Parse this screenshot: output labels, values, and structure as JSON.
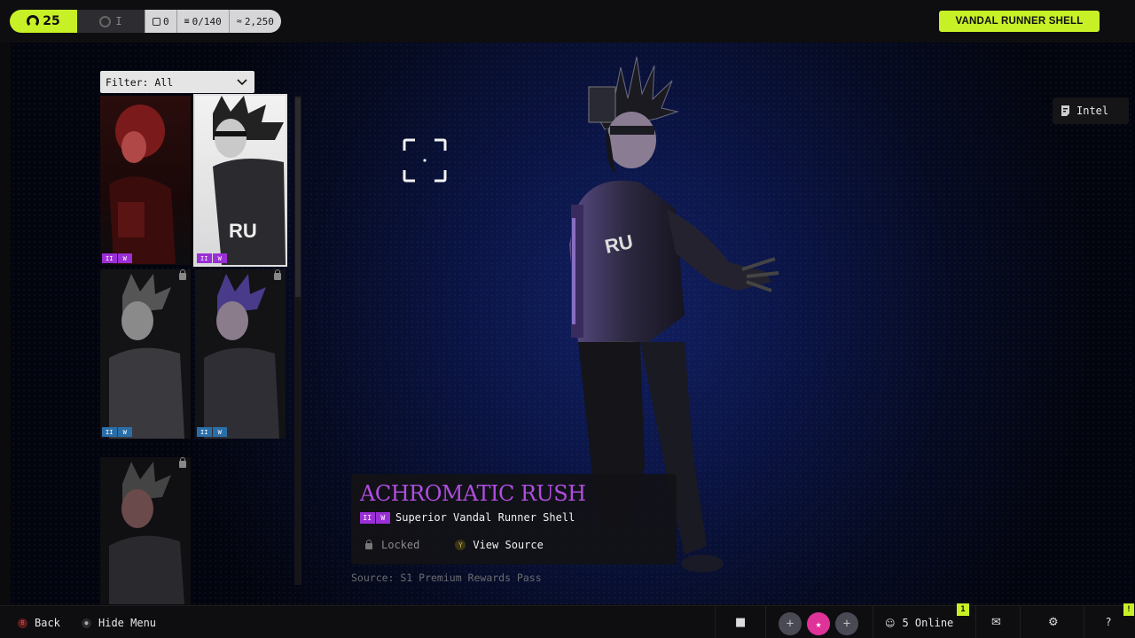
{
  "topbar": {
    "level": "25",
    "rank_label": "I",
    "stat_box": "0",
    "stat_progress": "0/140",
    "stat_currency": "2,250",
    "shell_badge": "VANDAL RUNNER SHELL"
  },
  "filter": {
    "label": "Filter: All"
  },
  "grid": {
    "items": [
      {
        "tag_left": "II",
        "tag_right": "W",
        "tag_color": "#9b2fd6",
        "locked": false
      },
      {
        "tag_left": "II",
        "tag_right": "W",
        "tag_color": "#9b2fd6",
        "locked": false
      },
      {
        "tag_left": "II",
        "tag_right": "W",
        "tag_color": "#2a6ea8",
        "locked": true
      },
      {
        "tag_left": "II",
        "tag_right": "W",
        "tag_color": "#2a6ea8",
        "locked": true
      },
      {
        "tag_left": "",
        "tag_right": "",
        "tag_color": "#2a6ea8",
        "locked": true
      }
    ]
  },
  "intel": {
    "label": "Intel"
  },
  "card": {
    "title": "ACHROMATIC RUSH",
    "tag_left": "II",
    "tag_right": "W",
    "subtitle": "Superior Vandal Runner Shell",
    "locked_label": "Locked",
    "view_button_key": "Y",
    "view_label": "View Source",
    "source": "Source: S1 Premium Rewards Pass"
  },
  "bottombar": {
    "back_key": "B",
    "back_label": "Back",
    "hide_menu_label": "Hide Menu",
    "online_label": "5 Online",
    "notification_count": "1",
    "alert_count": "!",
    "help_label": "?"
  },
  "colors": {
    "accent": "#c8f027",
    "title_purple": "#b04de0",
    "tag_purple": "#9b2fd6",
    "tag_blue": "#2a6ea8"
  }
}
